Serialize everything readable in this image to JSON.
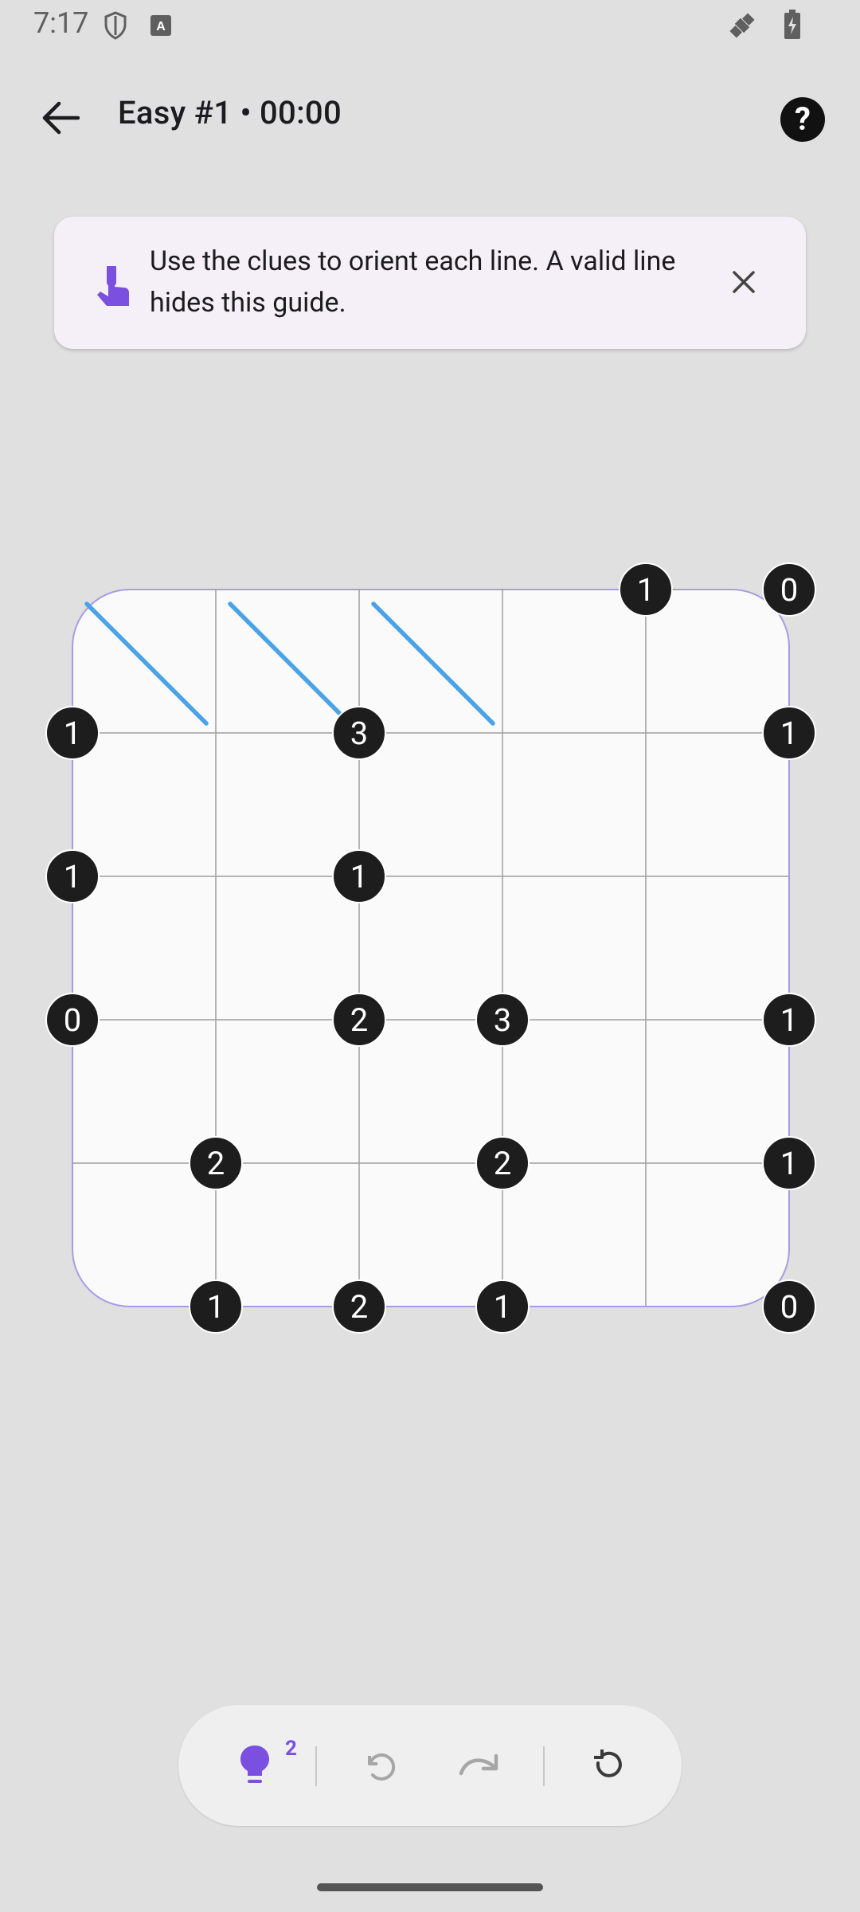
{
  "status_bar": {
    "time": "7:17"
  },
  "header": {
    "title": "Easy #1 • 00:00"
  },
  "guide": {
    "text": "Use the clues to orient each line. A valid line hides this guide."
  },
  "toolbar": {
    "hint_count": "2"
  },
  "board": {
    "size": 5,
    "lines": [
      {
        "row": 0,
        "col": 0,
        "dir": "backslash"
      },
      {
        "row": 0,
        "col": 1,
        "dir": "backslash"
      },
      {
        "row": 0,
        "col": 2,
        "dir": "backslash"
      }
    ],
    "clues": [
      {
        "r": 0,
        "c": 4,
        "v": "1"
      },
      {
        "r": 0,
        "c": 5,
        "v": "0"
      },
      {
        "r": 1,
        "c": 0,
        "v": "1"
      },
      {
        "r": 1,
        "c": 2,
        "v": "3"
      },
      {
        "r": 1,
        "c": 5,
        "v": "1"
      },
      {
        "r": 2,
        "c": 0,
        "v": "1"
      },
      {
        "r": 2,
        "c": 2,
        "v": "1"
      },
      {
        "r": 3,
        "c": 0,
        "v": "0"
      },
      {
        "r": 3,
        "c": 2,
        "v": "2"
      },
      {
        "r": 3,
        "c": 3,
        "v": "3"
      },
      {
        "r": 3,
        "c": 5,
        "v": "1"
      },
      {
        "r": 4,
        "c": 1,
        "v": "2"
      },
      {
        "r": 4,
        "c": 3,
        "v": "2"
      },
      {
        "r": 4,
        "c": 5,
        "v": "1"
      },
      {
        "r": 5,
        "c": 1,
        "v": "1"
      },
      {
        "r": 5,
        "c": 2,
        "v": "2"
      },
      {
        "r": 5,
        "c": 3,
        "v": "1"
      },
      {
        "r": 5,
        "c": 5,
        "v": "0"
      }
    ],
    "colors": {
      "line": "#4aa3e6",
      "grid": "#9e9e9e",
      "border": "#a89be8",
      "clue_bg": "#1d1d1d"
    }
  }
}
